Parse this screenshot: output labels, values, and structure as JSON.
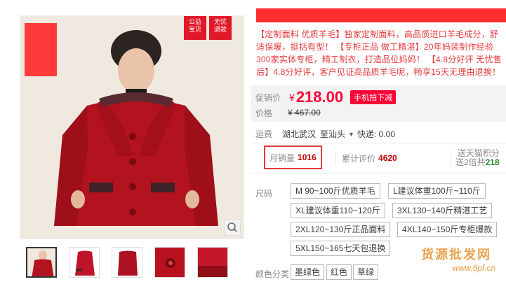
{
  "badges": {
    "b1": [
      "公益",
      "宝贝"
    ],
    "b2": [
      "无忧",
      "退款"
    ]
  },
  "subtitle": "【定制面料 优质羊毛】独家定制面料，高品质进口羊毛成分，舒适保暖，挺括有型！ 【专柜正品 做工精湛】20年妈装制作经验 300家实体专柜，精工制衣，打造品位妈妈！ 【4.8分好评 无忧售后】4.8分好评，客户见证高品质羊毛呢，畅享15天无理由退换！",
  "price": {
    "promo_label": "促销价",
    "currency": "¥",
    "promo_value": "218.00",
    "mobile_tag": "手机拍下减",
    "orig_label": "价格",
    "orig_value": "467.00"
  },
  "shipping": {
    "label": "运费",
    "from": "湖北武汉",
    "to": "至汕头",
    "fee": "快递: 0.00"
  },
  "stats": {
    "sales_label": "月销量",
    "sales_value": "1016",
    "reviews_label": "累计评价",
    "reviews_value": "4620",
    "points_line1": "送天猫积分",
    "points_prefix": "送2倍共",
    "points_value": "218"
  },
  "size": {
    "label": "尺码",
    "options": [
      "M 90~100斤优质羊毛",
      "L建议体重100斤~110斤",
      "XL建议体重110~120斤",
      "3XL130~140斤精湛工艺",
      "2XL120~130斤正品面料",
      "4XL140~150斤专柜爆款",
      "5XL150~165七天包退换"
    ]
  },
  "color": {
    "label": "颜色分类",
    "options": [
      "墨绿色",
      "红色",
      "草绿"
    ]
  },
  "watermark": {
    "text": "货源批发网",
    "url": "www.6pf.cn"
  },
  "colors": {
    "accent": "#ff0036",
    "coat": "#b3121f",
    "badge": "#e0192a"
  }
}
